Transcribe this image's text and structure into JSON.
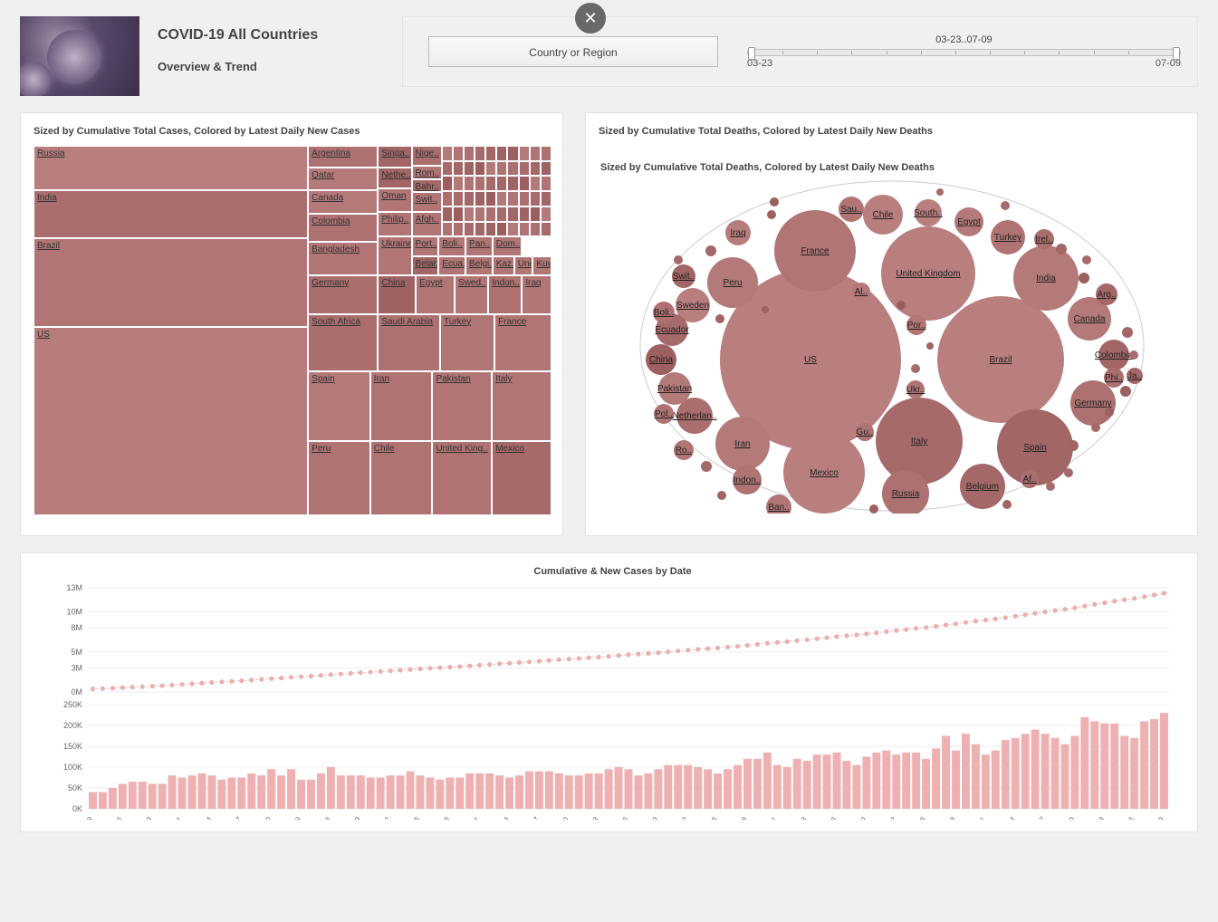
{
  "header": {
    "title": "COVID-19 All Countries",
    "subtitle": "Overview & Trend",
    "country_selector_label": "Country or Region",
    "date_range_label": "03-23..07-09",
    "date_start": "03-23",
    "date_end": "07-09"
  },
  "treemap": {
    "title": "Sized by Cumulative Total Cases, Colored by Latest Daily New Cases"
  },
  "bubbles": {
    "title": "Sized by Cumulative Total Deaths, Colored by Latest Daily New Deaths",
    "subtitle": "Sized by Cumulative Total Deaths, Colored by Latest Daily New Deaths"
  },
  "combo": {
    "title": "Cumulative & New Cases by Date"
  },
  "chart_data": [
    {
      "type": "treemap",
      "title": "Sized by Cumulative Total Cases, Colored by Latest Daily New Cases",
      "size_metric": "cumulative_total_cases",
      "color_metric": "latest_daily_new_cases",
      "nodes": [
        {
          "name": "US",
          "size": 3200000,
          "color_intensity": 0.42
        },
        {
          "name": "Brazil",
          "size": 1800000,
          "color_intensity": 0.48
        },
        {
          "name": "India",
          "size": 820000,
          "color_intensity": 0.55
        },
        {
          "name": "Russia",
          "size": 720000,
          "color_intensity": 0.4
        },
        {
          "name": "Peru",
          "size": 320000,
          "color_intensity": 0.5
        },
        {
          "name": "Chile",
          "size": 310000,
          "color_intensity": 0.5
        },
        {
          "name": "Spain",
          "size": 300000,
          "color_intensity": 0.45
        },
        {
          "name": "United Kingdom",
          "size": 290000,
          "color_intensity": 0.5
        },
        {
          "name": "Mexico",
          "size": 285000,
          "color_intensity": 0.58
        },
        {
          "name": "South Africa",
          "size": 250000,
          "color_intensity": 0.55
        },
        {
          "name": "Iran",
          "size": 250000,
          "color_intensity": 0.5
        },
        {
          "name": "Pakistan",
          "size": 245000,
          "color_intensity": 0.48
        },
        {
          "name": "Italy",
          "size": 242000,
          "color_intensity": 0.48
        },
        {
          "name": "Saudi Arabia",
          "size": 225000,
          "color_intensity": 0.52
        },
        {
          "name": "Turkey",
          "size": 210000,
          "color_intensity": 0.48
        },
        {
          "name": "France",
          "size": 205000,
          "color_intensity": 0.48
        },
        {
          "name": "Germany",
          "size": 200000,
          "color_intensity": 0.55
        },
        {
          "name": "Bangladesh",
          "size": 180000,
          "color_intensity": 0.48
        },
        {
          "name": "Colombia",
          "size": 140000,
          "color_intensity": 0.52
        },
        {
          "name": "Canada",
          "size": 108000,
          "color_intensity": 0.45
        },
        {
          "name": "Qatar",
          "size": 102000,
          "color_intensity": 0.45
        },
        {
          "name": "Argentina",
          "size": 95000,
          "color_intensity": 0.52
        },
        {
          "name": "China",
          "size": 85000,
          "color_intensity": 0.65
        },
        {
          "name": "Egypt",
          "size": 80000,
          "color_intensity": 0.48
        },
        {
          "name": "Sweden",
          "size": 75000,
          "color_intensity": 0.48
        },
        {
          "name": "Indonesia",
          "size": 72000,
          "color_intensity": 0.52
        },
        {
          "name": "Iraq",
          "size": 70000,
          "color_intensity": 0.48
        },
        {
          "name": "Belarus",
          "size": 65000,
          "color_intensity": 0.62
        },
        {
          "name": "Ecuador",
          "size": 65000,
          "color_intensity": 0.48
        },
        {
          "name": "Belgium",
          "size": 62000,
          "color_intensity": 0.48
        },
        {
          "name": "Kazakhstan",
          "size": 55000,
          "color_intensity": 0.48
        },
        {
          "name": "United Arab Emirates",
          "size": 54000,
          "color_intensity": 0.48
        },
        {
          "name": "Kuwait",
          "size": 53000,
          "color_intensity": 0.48
        },
        {
          "name": "Ukraine",
          "size": 53000,
          "color_intensity": 0.48
        },
        {
          "name": "Oman",
          "size": 52000,
          "color_intensity": 0.48
        },
        {
          "name": "Philippines",
          "size": 52000,
          "color_intensity": 0.48
        },
        {
          "name": "Netherlands",
          "size": 51000,
          "color_intensity": 0.62
        },
        {
          "name": "Singapore",
          "size": 45000,
          "color_intensity": 0.62
        },
        {
          "name": "Portugal",
          "size": 45000,
          "color_intensity": 0.48
        },
        {
          "name": "Bolivia",
          "size": 44000,
          "color_intensity": 0.48
        },
        {
          "name": "Panama",
          "size": 43000,
          "color_intensity": 0.48
        },
        {
          "name": "Dominican Republic",
          "size": 42000,
          "color_intensity": 0.48
        },
        {
          "name": "Afghanistan",
          "size": 34000,
          "color_intensity": 0.48
        },
        {
          "name": "Switzerland",
          "size": 33000,
          "color_intensity": 0.48
        },
        {
          "name": "Nigeria",
          "size": 31000,
          "color_intensity": 0.55
        },
        {
          "name": "Romania",
          "size": 31000,
          "color_intensity": 0.48
        },
        {
          "name": "Bahrain",
          "size": 31000,
          "color_intensity": 0.6
        }
      ]
    },
    {
      "type": "bubble",
      "title": "Sized by Cumulative Total Deaths, Colored by Latest Daily New Deaths",
      "size_metric": "cumulative_total_deaths",
      "color_metric": "latest_daily_new_deaths",
      "nodes": [
        {
          "name": "US",
          "size": 135000,
          "color_intensity": 0.42
        },
        {
          "name": "Brazil",
          "size": 70000,
          "color_intensity": 0.42
        },
        {
          "name": "United Kingdom",
          "size": 44000,
          "color_intensity": 0.42
        },
        {
          "name": "Italy",
          "size": 35000,
          "color_intensity": 0.58
        },
        {
          "name": "Mexico",
          "size": 34000,
          "color_intensity": 0.42
        },
        {
          "name": "France",
          "size": 30000,
          "color_intensity": 0.48
        },
        {
          "name": "Spain",
          "size": 28000,
          "color_intensity": 0.62
        },
        {
          "name": "India",
          "size": 22000,
          "color_intensity": 0.45
        },
        {
          "name": "Iran",
          "size": 12000,
          "color_intensity": 0.45
        },
        {
          "name": "Peru",
          "size": 11000,
          "color_intensity": 0.45
        },
        {
          "name": "Russia",
          "size": 11000,
          "color_intensity": 0.52
        },
        {
          "name": "Belgium",
          "size": 9800,
          "color_intensity": 0.6
        },
        {
          "name": "Germany",
          "size": 9000,
          "color_intensity": 0.52
        },
        {
          "name": "Canada",
          "size": 8800,
          "color_intensity": 0.45
        },
        {
          "name": "Chile",
          "size": 7000,
          "color_intensity": 0.42
        },
        {
          "name": "Netherlands",
          "size": 6100,
          "color_intensity": 0.55
        },
        {
          "name": "Sweden",
          "size": 5500,
          "color_intensity": 0.42
        },
        {
          "name": "Turkey",
          "size": 5300,
          "color_intensity": 0.5
        },
        {
          "name": "Colombia",
          "size": 5000,
          "color_intensity": 0.62
        },
        {
          "name": "Ecuador",
          "size": 5000,
          "color_intensity": 0.58
        },
        {
          "name": "China",
          "size": 4600,
          "color_intensity": 0.65
        },
        {
          "name": "Pakistan",
          "size": 5300,
          "color_intensity": 0.45
        },
        {
          "name": "Egypt",
          "size": 4000,
          "color_intensity": 0.45
        },
        {
          "name": "Indonesia",
          "size": 3500,
          "color_intensity": 0.5
        },
        {
          "name": "Iraq",
          "size": 3000,
          "color_intensity": 0.42
        },
        {
          "name": "South Africa",
          "size": 3700,
          "color_intensity": 0.42
        },
        {
          "name": "Saudi Arabia",
          "size": 2200,
          "color_intensity": 0.48
        },
        {
          "name": "Switzerland",
          "size": 2000,
          "color_intensity": 0.62
        },
        {
          "name": "Bolivia",
          "size": 1800,
          "color_intensity": 0.52
        },
        {
          "name": "Argentina",
          "size": 1800,
          "color_intensity": 0.6
        },
        {
          "name": "Ireland",
          "size": 1700,
          "color_intensity": 0.55
        },
        {
          "name": "Portugal",
          "size": 1700,
          "color_intensity": 0.48
        },
        {
          "name": "Poland",
          "size": 1600,
          "color_intensity": 0.5
        },
        {
          "name": "Romania",
          "size": 1600,
          "color_intensity": 0.48
        },
        {
          "name": "Philippines",
          "size": 1400,
          "color_intensity": 0.55
        },
        {
          "name": "Ukraine",
          "size": 1400,
          "color_intensity": 0.5
        },
        {
          "name": "Guatemala",
          "size": 1100,
          "color_intensity": 0.5
        },
        {
          "name": "Bangladesh",
          "size": 2300,
          "color_intensity": 0.48
        },
        {
          "name": "Algeria",
          "size": 1000,
          "color_intensity": 0.45
        },
        {
          "name": "Japan",
          "size": 1000,
          "color_intensity": 0.6
        },
        {
          "name": "Afghanistan",
          "size": 1000,
          "color_intensity": 0.55
        }
      ]
    },
    {
      "type": "line",
      "title": "Cumulative & New Cases by Date — cumulative (top)",
      "x": [
        "03/23",
        "03/24",
        "03/25",
        "03/26",
        "03/27",
        "03/28",
        "03/29",
        "03/30",
        "03/31",
        "04/01",
        "04/02",
        "04/03",
        "04/04",
        "04/05",
        "04/06",
        "04/07",
        "04/08",
        "04/09",
        "04/10",
        "04/11",
        "04/12",
        "04/13",
        "04/14",
        "04/15",
        "04/16",
        "04/17",
        "04/18",
        "04/19",
        "04/20",
        "04/21",
        "04/22",
        "04/23",
        "04/24",
        "04/25",
        "04/26",
        "04/27",
        "04/28",
        "04/29",
        "04/30",
        "05/01",
        "05/02",
        "05/03",
        "05/04",
        "05/05",
        "05/06",
        "05/07",
        "05/08",
        "05/09",
        "05/10",
        "05/11",
        "05/12",
        "05/13",
        "05/14",
        "05/15",
        "05/16",
        "05/17",
        "05/18",
        "05/19",
        "05/20",
        "05/21",
        "05/22",
        "05/23",
        "05/24",
        "05/25",
        "05/26",
        "05/27",
        "05/28",
        "05/29",
        "05/30",
        "05/31",
        "06/01",
        "06/02",
        "06/03",
        "06/04",
        "06/05",
        "06/06",
        "06/07",
        "06/08",
        "06/09",
        "06/10",
        "06/11",
        "06/12",
        "06/13",
        "06/14",
        "06/15",
        "06/16",
        "06/17",
        "06/18",
        "06/19",
        "06/20",
        "06/21",
        "06/22",
        "06/23",
        "06/24",
        "06/25",
        "06/26",
        "06/27",
        "06/28",
        "06/29",
        "06/30",
        "07/01",
        "07/02",
        "07/03",
        "07/04",
        "07/05",
        "07/06",
        "07/07",
        "07/08",
        "07/09"
      ],
      "y": [
        380000,
        420000,
        470000,
        530000,
        595000,
        660000,
        720000,
        780000,
        860000,
        935000,
        1015000,
        1100000,
        1180000,
        1250000,
        1325000,
        1400000,
        1485000,
        1565000,
        1660000,
        1740000,
        1835000,
        1905000,
        1975000,
        2060000,
        2160000,
        2240000,
        2320000,
        2400000,
        2475000,
        2550000,
        2630000,
        2710000,
        2800000,
        2880000,
        2955000,
        3025000,
        3100000,
        3175000,
        3260000,
        3345000,
        3430000,
        3510000,
        3585000,
        3665000,
        3755000,
        3845000,
        3935000,
        4020000,
        4100000,
        4180000,
        4265000,
        4350000,
        4445000,
        4545000,
        4640000,
        4720000,
        4805000,
        4900000,
        5005000,
        5110000,
        5215000,
        5315000,
        5410000,
        5495000,
        5590000,
        5695000,
        5815000,
        5935000,
        6070000,
        6175000,
        6275000,
        6395000,
        6510000,
        6640000,
        6770000,
        6905000,
        7020000,
        7125000,
        7250000,
        7385000,
        7525000,
        7655000,
        7790000,
        7925000,
        8045000,
        8190000,
        8365000,
        8505000,
        8685000,
        8840000,
        8970000,
        9110000,
        9275000,
        9445000,
        9625000,
        9815000,
        9995000,
        10165000,
        10320000,
        10495000,
        10715000,
        10925000,
        11130000,
        11335000,
        11510000,
        11680000,
        11890000,
        12105000,
        12320000
      ],
      "ylabel": "",
      "ylim": [
        0,
        13000000
      ],
      "y_ticks": [
        "0M",
        "3M",
        "5M",
        "8M",
        "10M",
        "13M"
      ]
    },
    {
      "type": "bar",
      "title": "Cumulative & New Cases by Date — daily new (bottom)",
      "categories": [
        "03/23",
        "03/24",
        "03/25",
        "03/26",
        "03/27",
        "03/28",
        "03/29",
        "03/30",
        "03/31",
        "04/01",
        "04/02",
        "04/03",
        "04/04",
        "04/05",
        "04/06",
        "04/07",
        "04/08",
        "04/09",
        "04/10",
        "04/11",
        "04/12",
        "04/13",
        "04/14",
        "04/15",
        "04/16",
        "04/17",
        "04/18",
        "04/19",
        "04/20",
        "04/21",
        "04/22",
        "04/23",
        "04/24",
        "04/25",
        "04/26",
        "04/27",
        "04/28",
        "04/29",
        "04/30",
        "05/01",
        "05/02",
        "05/03",
        "05/04",
        "05/05",
        "05/06",
        "05/07",
        "05/08",
        "05/09",
        "05/10",
        "05/11",
        "05/12",
        "05/13",
        "05/14",
        "05/15",
        "05/16",
        "05/17",
        "05/18",
        "05/19",
        "05/20",
        "05/21",
        "05/22",
        "05/23",
        "05/24",
        "05/25",
        "05/26",
        "05/27",
        "05/28",
        "05/29",
        "05/30",
        "05/31",
        "06/01",
        "06/02",
        "06/03",
        "06/04",
        "06/05",
        "06/06",
        "06/07",
        "06/08",
        "06/09",
        "06/10",
        "06/11",
        "06/12",
        "06/13",
        "06/14",
        "06/15",
        "06/16",
        "06/17",
        "06/18",
        "06/19",
        "06/20",
        "06/21",
        "06/22",
        "06/23",
        "06/24",
        "06/25",
        "06/26",
        "06/27",
        "06/28",
        "06/29",
        "06/30",
        "07/01",
        "07/02",
        "07/03",
        "07/04",
        "07/05",
        "07/06",
        "07/07",
        "07/08",
        "07/09"
      ],
      "values": [
        40000,
        40000,
        50000,
        60000,
        65000,
        65000,
        60000,
        60000,
        80000,
        75000,
        80000,
        85000,
        80000,
        70000,
        75000,
        75000,
        85000,
        80000,
        95000,
        80000,
        95000,
        70000,
        70000,
        85000,
        100000,
        80000,
        80000,
        80000,
        75000,
        75000,
        80000,
        80000,
        90000,
        80000,
        75000,
        70000,
        75000,
        75000,
        85000,
        85000,
        85000,
        80000,
        75000,
        80000,
        90000,
        90000,
        90000,
        85000,
        80000,
        80000,
        85000,
        85000,
        95000,
        100000,
        95000,
        80000,
        85000,
        95000,
        105000,
        105000,
        105000,
        100000,
        95000,
        85000,
        95000,
        105000,
        120000,
        120000,
        135000,
        105000,
        100000,
        120000,
        115000,
        130000,
        130000,
        135000,
        115000,
        105000,
        125000,
        135000,
        140000,
        130000,
        135000,
        135000,
        120000,
        145000,
        175000,
        140000,
        180000,
        155000,
        130000,
        140000,
        165000,
        170000,
        180000,
        190000,
        180000,
        170000,
        155000,
        175000,
        220000,
        210000,
        205000,
        205000,
        175000,
        170000,
        210000,
        215000,
        230000
      ],
      "ylim": [
        0,
        250000
      ],
      "y_ticks": [
        "0K",
        "50K",
        "100K",
        "150K",
        "200K",
        "250K"
      ],
      "x_ticks": [
        "03/23",
        "03/26",
        "03/29",
        "04/01",
        "04/04",
        "04/07",
        "04/10",
        "04/13",
        "04/16",
        "04/19",
        "04/22",
        "04/25",
        "04/28",
        "05/01",
        "05/04",
        "05/07",
        "05/10",
        "05/13",
        "05/16",
        "05/19",
        "05/22",
        "05/25",
        "05/28",
        "05/31",
        "06/03",
        "06/06",
        "06/09",
        "06/12",
        "06/15",
        "06/18",
        "06/21",
        "06/24",
        "06/27",
        "06/30",
        "07/03",
        "07/06",
        "07/09"
      ]
    }
  ]
}
